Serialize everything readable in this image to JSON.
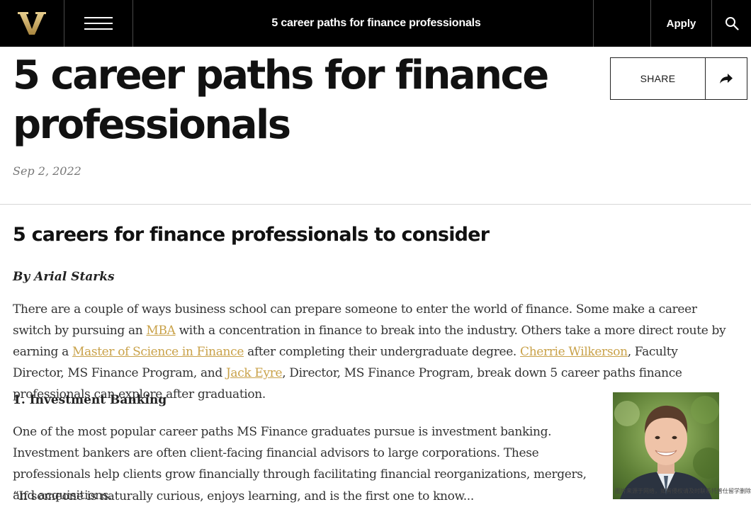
{
  "nav": {
    "page_title": "5 career paths for finance professionals",
    "apply_label": "Apply"
  },
  "article": {
    "headline_line1": "5 career paths for finance",
    "headline_line2": "professionals",
    "date": "Sep 2, 2022",
    "share_label": "SHARE",
    "subheading": "5 careers for finance professionals to consider",
    "byline": "By Arial Starks",
    "intro": {
      "t1": "There are a couple of ways business school can prepare someone to enter the world of finance. Some make a career switch by pursuing an ",
      "link_mba": "MBA",
      "t2": " with a concentration in finance to break into the industry. Others take a more direct route by earning a ",
      "link_msf": "Master of Science in Finance",
      "t3": " after completing their undergraduate degree. ",
      "link_wilkerson": "Cherrie Wilkerson",
      "t4": ", Faculty Director, MS Finance Program, and ",
      "link_eyre": "Jack Eyre",
      "t5": ", Director, MS Finance Program, break down 5 career paths finance professionals can explore after graduation."
    },
    "section1_title": "1. Investment Banking",
    "section1_text": "One of the most popular career paths MS Finance graduates pursue is investment banking. Investment bankers are often client-facing financial advisors to large corporations. These professionals help clients grow financially through facilitating financial reorganizations, mergers, and acquisitions.",
    "cut_line": "“If someone is naturally curious, enjoys learning, and is the first one to know..."
  },
  "watermark": "图片来源于网络，如有侵权请及时联系托普仕留学删除",
  "colors": {
    "nav_bg": "#000000",
    "link": "#c9a24a",
    "logo_gold": "#cfae6b"
  }
}
